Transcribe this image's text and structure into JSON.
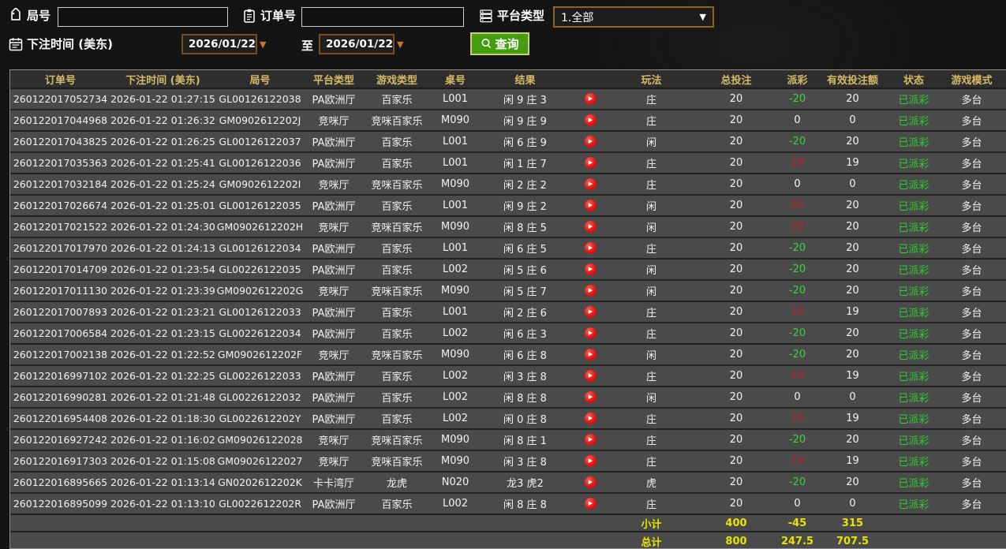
{
  "filters": {
    "round_label": "局号",
    "round_value": "",
    "order_label": "订单号",
    "order_value": "",
    "platform_label": "平台类型",
    "platform_value": "1.全部",
    "bet_time_label": "下注时间 (美东)",
    "date_from": "2026/01/22",
    "to_label": "至",
    "date_to": "2026/01/22",
    "query_label": "查询"
  },
  "icons": {
    "round": "tag-icon",
    "order": "clipboard-icon",
    "platform": "server-icon",
    "bet_time": "calendar-icon",
    "query": "search-icon",
    "row_action": "play-icon"
  },
  "colors": {
    "header_text": "#d8ba66",
    "row_bg": "#4a4a4a",
    "payout_positive": "#bd1f2d",
    "payout_negative": "#3bd23b",
    "status_green": "#2ecc2e",
    "footer_yellow": "#e8e400",
    "query_green": "#449c10"
  },
  "table": {
    "headers": [
      "订单号",
      "下注时间 (美东)",
      "局号",
      "平台类型",
      "游戏类型",
      "桌号",
      "结果",
      "",
      "玩法",
      "总投注",
      "派彩",
      "有效投注额",
      "状态",
      "游戏模式"
    ],
    "rows": [
      {
        "order": "260122017052734",
        "time": "2026-01-22 01:27:15",
        "round": "GL00126122038",
        "platform": "PA欧洲厅",
        "game": "百家乐",
        "table_no": "L001",
        "result": "闲 9 庄 3",
        "bet": "庄",
        "total": "20",
        "payout": "-20",
        "payout_sign": "neg",
        "valid": "20",
        "status": "已派彩",
        "mode": "多台"
      },
      {
        "order": "260122017044968",
        "time": "2026-01-22 01:26:32",
        "round": "GM0902612202J",
        "platform": "竞咪厅",
        "game": "竞咪百家乐",
        "table_no": "M090",
        "result": "闲 9 庄 9",
        "bet": "庄",
        "total": "20",
        "payout": "0",
        "payout_sign": "zero",
        "valid": "0",
        "status": "已派彩",
        "mode": "多台"
      },
      {
        "order": "260122017043825",
        "time": "2026-01-22 01:26:25",
        "round": "GL00126122037",
        "platform": "PA欧洲厅",
        "game": "百家乐",
        "table_no": "L001",
        "result": "闲 6 庄 9",
        "bet": "闲",
        "total": "20",
        "payout": "-20",
        "payout_sign": "neg",
        "valid": "20",
        "status": "已派彩",
        "mode": "多台"
      },
      {
        "order": "260122017035363",
        "time": "2026-01-22 01:25:41",
        "round": "GL00126122036",
        "platform": "PA欧洲厅",
        "game": "百家乐",
        "table_no": "L001",
        "result": "闲 1 庄 7",
        "bet": "庄",
        "total": "20",
        "payout": "19",
        "payout_sign": "pos",
        "valid": "19",
        "status": "已派彩",
        "mode": "多台"
      },
      {
        "order": "260122017032184",
        "time": "2026-01-22 01:25:24",
        "round": "GM0902612202I",
        "platform": "竞咪厅",
        "game": "竞咪百家乐",
        "table_no": "M090",
        "result": "闲 2 庄 2",
        "bet": "庄",
        "total": "20",
        "payout": "0",
        "payout_sign": "zero",
        "valid": "0",
        "status": "已派彩",
        "mode": "多台"
      },
      {
        "order": "260122017026674",
        "time": "2026-01-22 01:25:01",
        "round": "GL00126122035",
        "platform": "PA欧洲厅",
        "game": "百家乐",
        "table_no": "L001",
        "result": "闲 9 庄 2",
        "bet": "闲",
        "total": "20",
        "payout": "20",
        "payout_sign": "pos",
        "valid": "20",
        "status": "已派彩",
        "mode": "多台"
      },
      {
        "order": "260122017021522",
        "time": "2026-01-22 01:24:30",
        "round": "GM0902612202H",
        "platform": "竞咪厅",
        "game": "竞咪百家乐",
        "table_no": "M090",
        "result": "闲 8 庄 5",
        "bet": "闲",
        "total": "20",
        "payout": "20",
        "payout_sign": "pos",
        "valid": "20",
        "status": "已派彩",
        "mode": "多台"
      },
      {
        "order": "260122017017970",
        "time": "2026-01-22 01:24:13",
        "round": "GL00126122034",
        "platform": "PA欧洲厅",
        "game": "百家乐",
        "table_no": "L001",
        "result": "闲 6 庄 5",
        "bet": "庄",
        "total": "20",
        "payout": "-20",
        "payout_sign": "neg",
        "valid": "20",
        "status": "已派彩",
        "mode": "多台"
      },
      {
        "order": "260122017014709",
        "time": "2026-01-22 01:23:54",
        "round": "GL00226122035",
        "platform": "PA欧洲厅",
        "game": "百家乐",
        "table_no": "L002",
        "result": "闲 5 庄 6",
        "bet": "闲",
        "total": "20",
        "payout": "-20",
        "payout_sign": "neg",
        "valid": "20",
        "status": "已派彩",
        "mode": "多台"
      },
      {
        "order": "260122017011130",
        "time": "2026-01-22 01:23:39",
        "round": "GM0902612202G",
        "platform": "竞咪厅",
        "game": "竞咪百家乐",
        "table_no": "M090",
        "result": "闲 5 庄 7",
        "bet": "闲",
        "total": "20",
        "payout": "-20",
        "payout_sign": "neg",
        "valid": "20",
        "status": "已派彩",
        "mode": "多台"
      },
      {
        "order": "260122017007893",
        "time": "2026-01-22 01:23:21",
        "round": "GL00126122033",
        "platform": "PA欧洲厅",
        "game": "百家乐",
        "table_no": "L001",
        "result": "闲 2 庄 6",
        "bet": "庄",
        "total": "20",
        "payout": "19",
        "payout_sign": "pos",
        "valid": "19",
        "status": "已派彩",
        "mode": "多台"
      },
      {
        "order": "260122017006584",
        "time": "2026-01-22 01:23:15",
        "round": "GL00226122034",
        "platform": "PA欧洲厅",
        "game": "百家乐",
        "table_no": "L002",
        "result": "闲 6 庄 3",
        "bet": "庄",
        "total": "20",
        "payout": "-20",
        "payout_sign": "neg",
        "valid": "20",
        "status": "已派彩",
        "mode": "多台"
      },
      {
        "order": "260122017002138",
        "time": "2026-01-22 01:22:52",
        "round": "GM0902612202F",
        "platform": "竞咪厅",
        "game": "竞咪百家乐",
        "table_no": "M090",
        "result": "闲 6 庄 8",
        "bet": "闲",
        "total": "20",
        "payout": "-20",
        "payout_sign": "neg",
        "valid": "20",
        "status": "已派彩",
        "mode": "多台"
      },
      {
        "order": "260122016997102",
        "time": "2026-01-22 01:22:25",
        "round": "GL00226122033",
        "platform": "PA欧洲厅",
        "game": "百家乐",
        "table_no": "L002",
        "result": "闲 3 庄 8",
        "bet": "庄",
        "total": "20",
        "payout": "19",
        "payout_sign": "pos",
        "valid": "19",
        "status": "已派彩",
        "mode": "多台"
      },
      {
        "order": "260122016990281",
        "time": "2026-01-22 01:21:48",
        "round": "GL00226122032",
        "platform": "PA欧洲厅",
        "game": "百家乐",
        "table_no": "L002",
        "result": "闲 8 庄 8",
        "bet": "闲",
        "total": "20",
        "payout": "0",
        "payout_sign": "zero",
        "valid": "0",
        "status": "已派彩",
        "mode": "多台"
      },
      {
        "order": "260122016954408",
        "time": "2026-01-22 01:18:30",
        "round": "GL0022612202Y",
        "platform": "PA欧洲厅",
        "game": "百家乐",
        "table_no": "L002",
        "result": "闲 0 庄 8",
        "bet": "庄",
        "total": "20",
        "payout": "19",
        "payout_sign": "pos",
        "valid": "19",
        "status": "已派彩",
        "mode": "多台"
      },
      {
        "order": "260122016927242",
        "time": "2026-01-22 01:16:02",
        "round": "GM09026122028",
        "platform": "竞咪厅",
        "game": "竞咪百家乐",
        "table_no": "M090",
        "result": "闲 8 庄 1",
        "bet": "庄",
        "total": "20",
        "payout": "-20",
        "payout_sign": "neg",
        "valid": "20",
        "status": "已派彩",
        "mode": "多台"
      },
      {
        "order": "260122016917303",
        "time": "2026-01-22 01:15:08",
        "round": "GM09026122027",
        "platform": "竞咪厅",
        "game": "竞咪百家乐",
        "table_no": "M090",
        "result": "闲 3 庄 8",
        "bet": "庄",
        "total": "20",
        "payout": "19",
        "payout_sign": "pos",
        "valid": "19",
        "status": "已派彩",
        "mode": "多台"
      },
      {
        "order": "260122016895665",
        "time": "2026-01-22 01:13:14",
        "round": "GN0202612202K",
        "platform": "卡卡湾厅",
        "game": "龙虎",
        "table_no": "N020",
        "result": "龙3 虎2",
        "bet": "虎",
        "total": "20",
        "payout": "-20",
        "payout_sign": "neg",
        "valid": "20",
        "status": "已派彩",
        "mode": "多台"
      },
      {
        "order": "260122016895099",
        "time": "2026-01-22 01:13:10",
        "round": "GL0022612202R",
        "platform": "PA欧洲厅",
        "game": "百家乐",
        "table_no": "L002",
        "result": "闲 8 庄 8",
        "bet": "庄",
        "total": "20",
        "payout": "0",
        "payout_sign": "zero",
        "valid": "0",
        "status": "已派彩",
        "mode": "多台"
      }
    ],
    "subtotal": {
      "label": "小计",
      "total": "400",
      "payout": "-45",
      "valid": "315"
    },
    "total": {
      "label": "总计",
      "total": "800",
      "payout": "247.5",
      "valid": "707.5"
    }
  }
}
